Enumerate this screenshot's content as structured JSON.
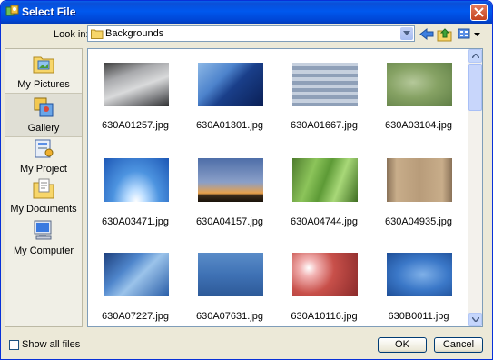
{
  "window": {
    "title": "Select File"
  },
  "lookin": {
    "label": "Look in:",
    "value": "Backgrounds"
  },
  "places": [
    {
      "label": "My Pictures",
      "icon": "my-pictures-icon"
    },
    {
      "label": "Gallery",
      "icon": "gallery-icon"
    },
    {
      "label": "My Project",
      "icon": "my-project-icon"
    },
    {
      "label": "My Documents",
      "icon": "my-documents-icon"
    },
    {
      "label": "My Computer",
      "icon": "my-computer-icon"
    }
  ],
  "files": [
    {
      "name": "630A01257.jpg"
    },
    {
      "name": "630A01301.jpg"
    },
    {
      "name": "630A01667.jpg"
    },
    {
      "name": "630A03104.jpg"
    },
    {
      "name": "630A03471.jpg"
    },
    {
      "name": "630A04157.jpg"
    },
    {
      "name": "630A04744.jpg"
    },
    {
      "name": "630A04935.jpg"
    },
    {
      "name": "630A07227.jpg"
    },
    {
      "name": "630A07631.jpg"
    },
    {
      "name": "630A10116.jpg"
    },
    {
      "name": "630B0011.jpg"
    }
  ],
  "footer": {
    "show_all_label": "Show all files",
    "ok_label": "OK",
    "cancel_label": "Cancel"
  },
  "colors": {
    "titlebar": "#0058ee",
    "chrome": "#ece9d8",
    "close": "#c4421f"
  }
}
